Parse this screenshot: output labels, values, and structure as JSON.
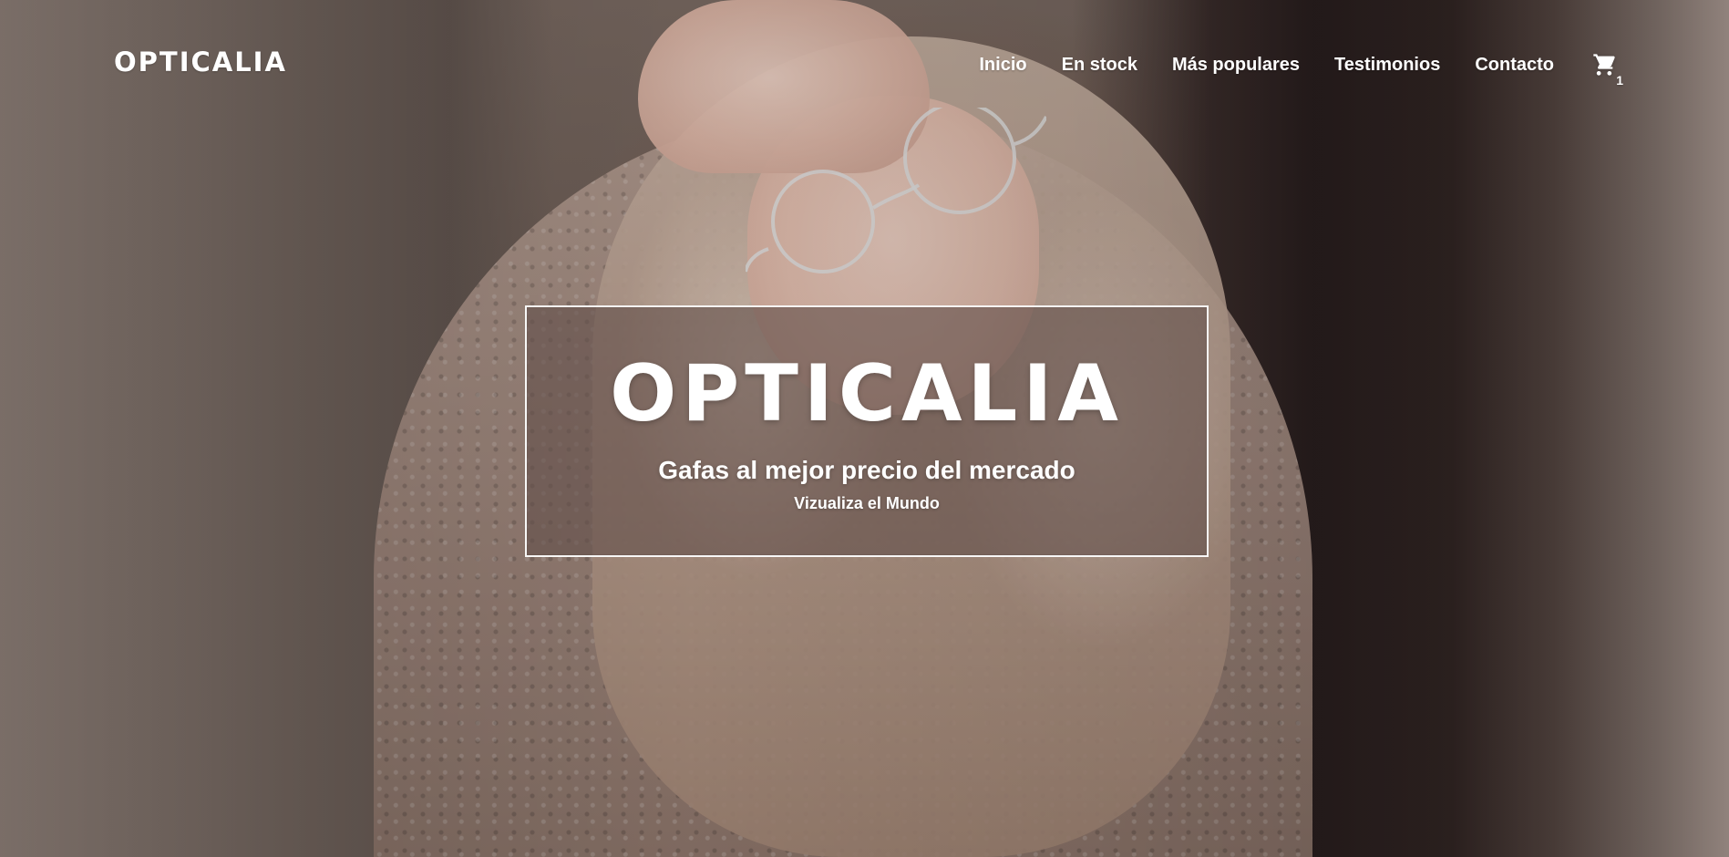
{
  "brand": {
    "logo_text": "OPTICALIA"
  },
  "nav": {
    "items": [
      {
        "label": "Inicio"
      },
      {
        "label": "En stock"
      },
      {
        "label": "Más populares"
      },
      {
        "label": "Testimonios"
      },
      {
        "label": "Contacto"
      }
    ],
    "cart": {
      "icon": "cart-icon",
      "count": "1"
    }
  },
  "hero": {
    "title": "OPTICALIA",
    "subtitle": "Gafas al mejor precio del mercado",
    "tagline": "Vizualiza el Mundo"
  },
  "colors": {
    "text": "#ffffff",
    "card_border": "#ffffff",
    "card_fill": "#624f4a"
  }
}
